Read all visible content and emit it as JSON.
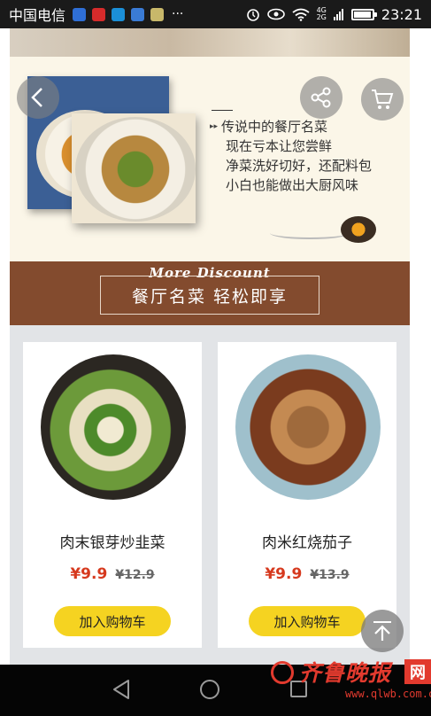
{
  "status_bar": {
    "carrier": "中国电信",
    "more": "···",
    "network": [
      "4G",
      "2G"
    ],
    "time": "23:21",
    "battery_level": 0.85
  },
  "banner": {
    "lines": [
      "传说中的餐厅名菜",
      "现在亏本让您尝鲜",
      "净菜洗好切好，还配料包",
      "小白也能做出大厨风味"
    ]
  },
  "promo": {
    "tag": "More Discount",
    "headline": "餐厅名菜 轻松即享"
  },
  "products": [
    {
      "name": "肉末银芽炒韭菜",
      "price": "¥9.9",
      "old_price": "¥12.9",
      "button": "加入购物车"
    },
    {
      "name": "肉米红烧茄子",
      "price": "¥9.9",
      "old_price": "¥13.9",
      "button": "加入购物车"
    }
  ],
  "watermark": {
    "brand": "齐鲁晚报",
    "badge": "网",
    "url": "www.qlwb.com.cn"
  },
  "colors": {
    "promo_bg": "#834b2e",
    "price_red": "#d6391e",
    "button_yellow": "#f5d321",
    "banner_bg": "#fbf6e8"
  }
}
